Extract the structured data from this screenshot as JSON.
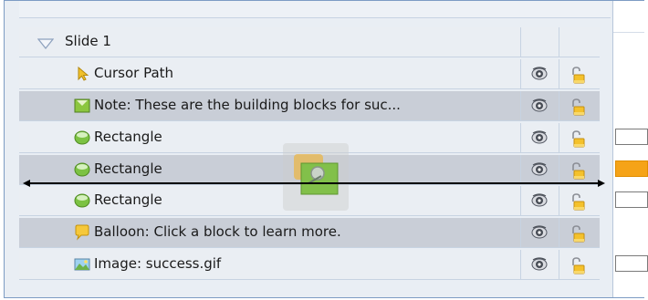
{
  "slide": {
    "label": "Slide 1"
  },
  "items": [
    {
      "label": "Cursor Path",
      "icon": "cursor-path-icon",
      "selected": false
    },
    {
      "label": "Note: These are the building blocks for suc...",
      "icon": "note-icon",
      "selected": true
    },
    {
      "label": "Rectangle",
      "icon": "rectangle-icon",
      "selected": false
    },
    {
      "label": "Rectangle",
      "icon": "rectangle-icon",
      "selected": true
    },
    {
      "label": "Rectangle",
      "icon": "rectangle-icon",
      "selected": false
    },
    {
      "label": "Balloon: Click a block to learn more.",
      "icon": "balloon-icon",
      "selected": true
    },
    {
      "label": "Image: success.gif",
      "icon": "image-icon",
      "selected": false
    }
  ],
  "colors": {
    "selected_row": "#c9ced7",
    "row": "#eaeef3",
    "timeline_highlight": "#f5a318"
  }
}
